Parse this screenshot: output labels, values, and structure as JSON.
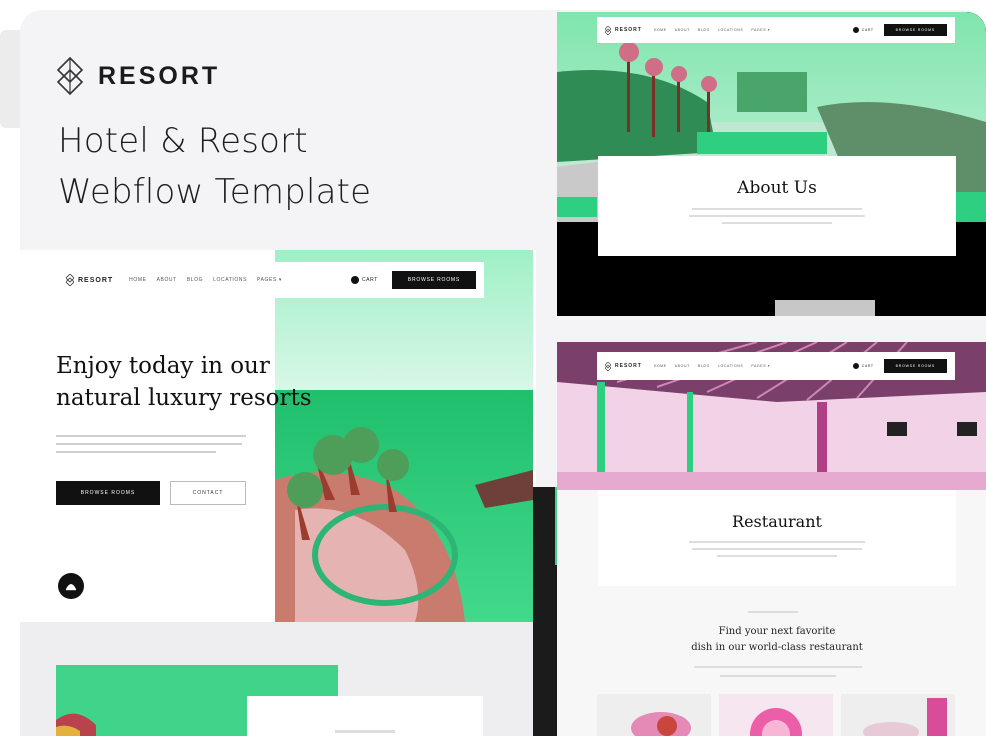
{
  "brand": {
    "name": "RESORT",
    "headline_line1": "Hotel & Resort",
    "headline_line2": "Webflow Template"
  },
  "colors": {
    "accent_green": "#3fd48a",
    "accent_pink": "#e887c4",
    "dark": "#111111"
  },
  "hero_mock": {
    "nav": {
      "logo": "RESORT",
      "links": [
        "HOME",
        "ABOUT",
        "BLOG",
        "LOCATIONS",
        "PAGES ▾"
      ],
      "cart": "CART",
      "cta": "BROWSE ROOMS"
    },
    "title_line1": "Enjoy today in our",
    "title_line2": "natural luxury resorts",
    "primary_button": "BROWSE ROOMS",
    "secondary_button": "CONTACT"
  },
  "about_mock": {
    "nav": {
      "logo": "RESORT",
      "links": [
        "HOME",
        "ABOUT",
        "BLOG",
        "LOCATIONS",
        "PAGES ▾"
      ],
      "cart": "CART",
      "cta": "BROWSE ROOMS"
    },
    "title": "About Us"
  },
  "restaurant_mock": {
    "nav": {
      "logo": "RESORT",
      "links": [
        "HOME",
        "ABOUT",
        "BLOG",
        "LOCATIONS",
        "PAGES ▾"
      ],
      "cart": "CART",
      "cta": "BROWSE ROOMS"
    },
    "title": "Restaurant",
    "subtitle_line1": "Find your next favorite",
    "subtitle_line2": "dish in our world-class restaurant"
  }
}
